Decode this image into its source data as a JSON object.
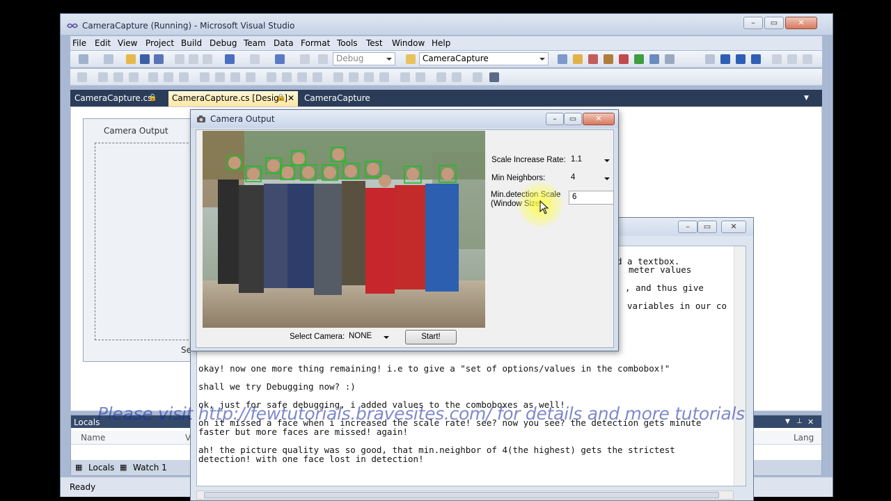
{
  "vs_window": {
    "title": "CameraCapture (Running) - Microsoft Visual Studio",
    "menu": [
      "File",
      "Edit",
      "View",
      "Project",
      "Build",
      "Debug",
      "Team",
      "Data",
      "Format",
      "Tools",
      "Test",
      "Window",
      "Help"
    ],
    "toolbar": {
      "config_value": "Debug",
      "project_value": "CameraCapture"
    },
    "doc_tabs": [
      "CameraCapture.cs",
      "CameraCapture.cs [Design]",
      "CameraCapture"
    ],
    "designer_form_title": "Camera Output",
    "designer_form_partial_label": "Se",
    "locals": {
      "title": "Locals",
      "columns": [
        "Name",
        "V",
        "Lang"
      ],
      "tabs": [
        "Locals",
        "Watch 1"
      ]
    },
    "status": "Ready"
  },
  "camera_window": {
    "title": "Camera Output",
    "scale_increase_rate_label": "Scale Increase Rate:",
    "scale_increase_rate_value": "1.1",
    "min_neighbors_label": "Min Neighbors:",
    "min_neighbors_value": "4",
    "min_detection_label_line1": "Min.detection Scale",
    "min_detection_label_line2": "(Window Size)",
    "min_detection_value": "6",
    "select_camera_label": "Select Camera:",
    "select_camera_value": "NONE",
    "start_button": "Start!"
  },
  "notes_window": {
    "partial_lines": [
      "d a textbox.",
      "meter values",
      ", and thus give",
      "variables in our co"
    ],
    "lines": [
      "okay! now one more thing remaining! i.e to give a \"set of options/values in the combobox!\"",
      "shall we try Debugging now? :)",
      "ok, just for safe debugging, i added values to the comboboxes as well!",
      "oh it missed a face when i increased the scale rate! see? now you see? the detection gets minute",
      "faster but more faces are missed! again!",
      "ah! the picture quality was so good, that min.neighbor of 4(the highest) gets the strictest",
      "detection! with one face lost in detection!"
    ]
  },
  "watermark": "Please visit http://fewtutorials.bravesites.com/ for details and more tutorials",
  "colors": {
    "vs_frame": "#a9b9d3",
    "tab_bar": "#2b3c59",
    "face_box": "#1fbf1f",
    "watermark": "#1428a0"
  }
}
